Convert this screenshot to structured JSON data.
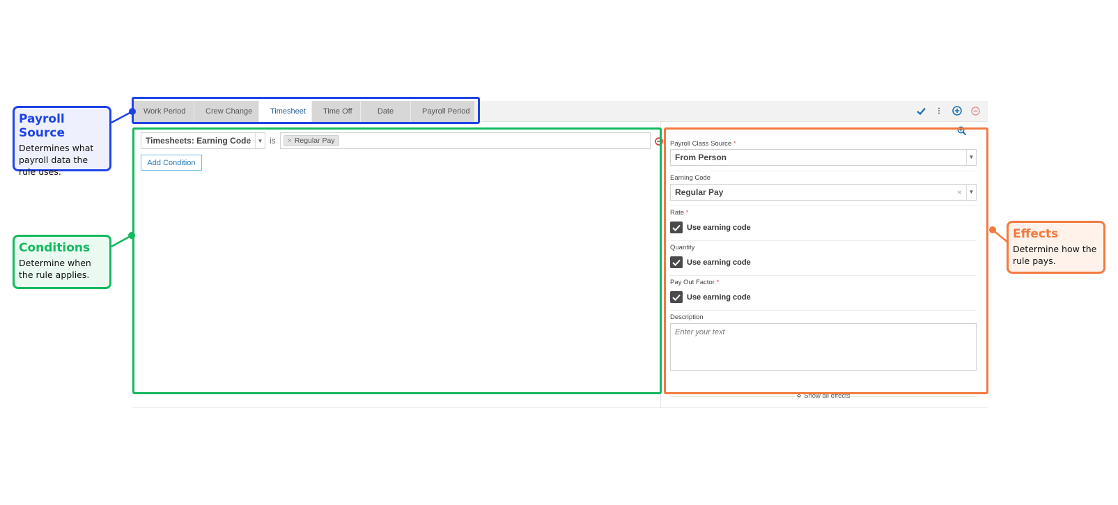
{
  "colors": {
    "payroll_source_accent": "#1d43e8",
    "conditions_accent": "#13b95e",
    "effects_accent": "#f27a3f",
    "link_blue": "#2a7fb8"
  },
  "tabs": [
    {
      "label": "Work Period",
      "active": false
    },
    {
      "label": "Crew Change",
      "active": false
    },
    {
      "label": "Timesheet",
      "active": true
    },
    {
      "label": "Time Off",
      "active": false
    },
    {
      "label": "Date",
      "active": false
    },
    {
      "label": "Payroll Period",
      "active": false
    }
  ],
  "header_actions": {
    "icons": [
      "checkmark-icon",
      "more-vertical-icon",
      "add-circle-icon",
      "remove-circle-icon"
    ]
  },
  "conditions": {
    "field": "Timesheets: Earning Code",
    "operator": "is",
    "values": [
      "Regular Pay"
    ],
    "add_button": "Add Condition"
  },
  "effects": {
    "payroll_class_source": {
      "label": "Payroll Class Source",
      "required": "*",
      "value": "From Person"
    },
    "earning_code": {
      "label": "Earning Code",
      "value": "Regular Pay"
    },
    "rate": {
      "label": "Rate",
      "required": "*",
      "checkbox_label": "Use earning code",
      "checked": true
    },
    "quantity": {
      "label": "Quantity",
      "checkbox_label": "Use earning code",
      "checked": true
    },
    "pay_out_factor": {
      "label": "Pay Out Factor",
      "required": "*",
      "checkbox_label": "Use earning code",
      "checked": true
    },
    "description": {
      "label": "Description",
      "placeholder": "Enter your text",
      "value": ""
    },
    "show_all": "Show all effects"
  },
  "callouts": {
    "payroll_source": {
      "title": "Payroll Source",
      "description": "Determines what payroll data the rule uses."
    },
    "conditions": {
      "title": "Conditions",
      "description": "Determine when the rule applies."
    },
    "effects": {
      "title": "Effects",
      "description": "Determine how the rule pays."
    }
  }
}
